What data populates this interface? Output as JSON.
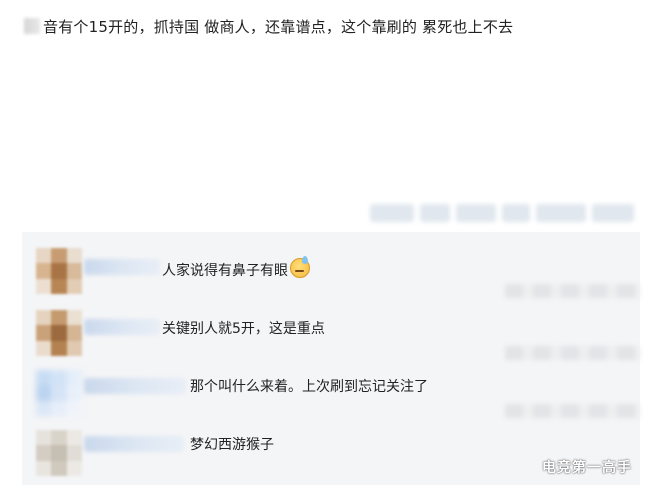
{
  "post": {
    "text": "音有个15开的，抓持国 做商人，还靠谱点，这个靠刷的 累死也上不去"
  },
  "comments": [
    {
      "text": "人家说得有鼻子有眼",
      "emoji": "sweat-smile-emoji"
    },
    {
      "text": "关键别人就5开，这是重点"
    },
    {
      "text": "那个叫什么来着。上次刷到忘记关注了"
    },
    {
      "text": "梦幻西游猴子"
    }
  ],
  "watermark": "电竞第一高手"
}
